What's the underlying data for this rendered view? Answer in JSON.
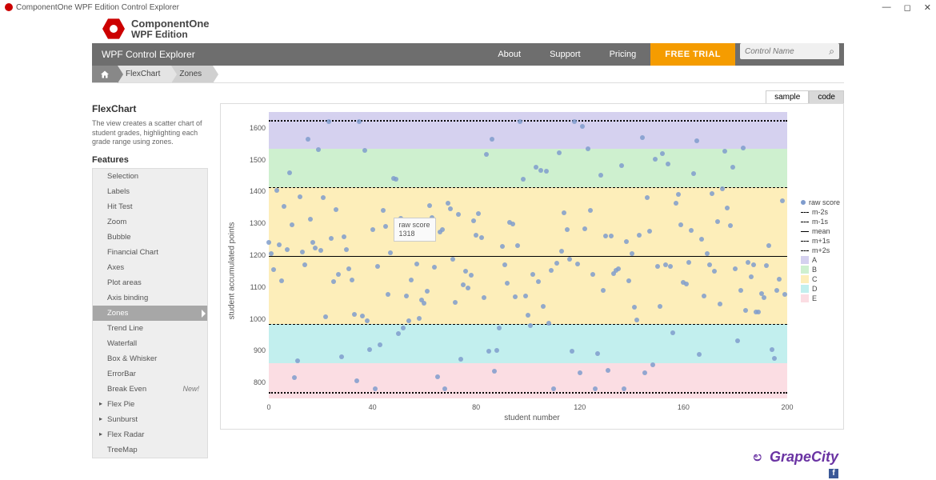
{
  "window": {
    "title": "ComponentOne WPF Edition Control Explorer"
  },
  "logo": {
    "line1": "ComponentOne",
    "line2": "WPF Edition"
  },
  "nav": {
    "title": "WPF Control Explorer",
    "links": [
      "About",
      "Support",
      "Pricing"
    ],
    "trial": "FREE TRIAL",
    "search_placeholder": "Control Name"
  },
  "breadcrumb": {
    "home": "⌂",
    "items": [
      "FlexChart",
      "Zones"
    ]
  },
  "side": {
    "heading": "FlexChart",
    "desc": "The view creates a scatter chart of student grades, highlighting each grade range using zones.",
    "features_heading": "Features",
    "features": [
      {
        "label": "Selection"
      },
      {
        "label": "Labels"
      },
      {
        "label": "Hit Test"
      },
      {
        "label": "Zoom"
      },
      {
        "label": "Bubble"
      },
      {
        "label": "Financial Chart"
      },
      {
        "label": "Axes"
      },
      {
        "label": "Plot areas"
      },
      {
        "label": "Axis binding"
      },
      {
        "label": "Zones",
        "selected": true
      },
      {
        "label": "Trend Line"
      },
      {
        "label": "Waterfall"
      },
      {
        "label": "Box & Whisker"
      },
      {
        "label": "ErrorBar"
      },
      {
        "label": "Break Even",
        "new": "New!"
      },
      {
        "label": "Flex Pie",
        "caret": true
      },
      {
        "label": "Sunburst",
        "caret": true
      },
      {
        "label": "Flex Radar",
        "caret": true
      },
      {
        "label": "TreeMap"
      }
    ]
  },
  "tabs": {
    "sample": "sample",
    "code": "code",
    "active": "sample"
  },
  "tooltip": {
    "line1": "raw score",
    "line2": "1318"
  },
  "legend": [
    {
      "label": "raw score",
      "type": "dot",
      "color": "#7f9ccd"
    },
    {
      "label": "m-2s",
      "type": "dash",
      "color": "#000"
    },
    {
      "label": "m-1s",
      "type": "dash",
      "color": "#000"
    },
    {
      "label": "mean",
      "type": "solid",
      "color": "#000"
    },
    {
      "label": "m+1s",
      "type": "dash",
      "color": "#000"
    },
    {
      "label": "m+2s",
      "type": "dash",
      "color": "#000"
    },
    {
      "label": "A",
      "type": "sw",
      "color": "#d5d1ef"
    },
    {
      "label": "B",
      "type": "sw",
      "color": "#cef0cf"
    },
    {
      "label": "C",
      "type": "sw",
      "color": "#fdeeba"
    },
    {
      "label": "D",
      "type": "sw",
      "color": "#c2efee"
    },
    {
      "label": "E",
      "type": "sw",
      "color": "#fbdde3"
    }
  ],
  "footer": {
    "brand": "GrapeCity"
  },
  "chart_data": {
    "type": "scatter",
    "title": "",
    "xlabel": "student number",
    "ylabel": "student accumulated points",
    "xlim": [
      0,
      200
    ],
    "ylim": [
      750,
      1650
    ],
    "xticks": [
      0,
      40,
      80,
      120,
      160,
      200
    ],
    "yticks": [
      800,
      900,
      1000,
      1100,
      1200,
      1300,
      1400,
      1500,
      1600
    ],
    "zones": [
      {
        "name": "A",
        "from": 1535,
        "to": 1650,
        "color": "#d5d1ef"
      },
      {
        "name": "B",
        "from": 1413,
        "to": 1535,
        "color": "#cef0cf"
      },
      {
        "name": "C",
        "from": 983,
        "to": 1413,
        "color": "#fdeeba"
      },
      {
        "name": "D",
        "from": 860,
        "to": 983,
        "color": "#c2efee"
      },
      {
        "name": "E",
        "from": 750,
        "to": 860,
        "color": "#fbdde3"
      }
    ],
    "reference_lines": [
      {
        "name": "m+2s",
        "y": 1625,
        "style": "dots"
      },
      {
        "name": "m+1s",
        "y": 1413,
        "style": "dash"
      },
      {
        "name": "mean",
        "y": 1197,
        "style": "solid"
      },
      {
        "name": "m-1s",
        "y": 983,
        "style": "dash"
      },
      {
        "name": "m-2s",
        "y": 770,
        "style": "dots"
      }
    ],
    "series": [
      {
        "name": "raw score",
        "x_range": [
          0,
          200
        ],
        "n_points": 200,
        "y_distribution": "~N(1197,215) clipped to [780,1620]"
      }
    ],
    "tooltip_point": {
      "x": 48,
      "y": 1318
    }
  }
}
